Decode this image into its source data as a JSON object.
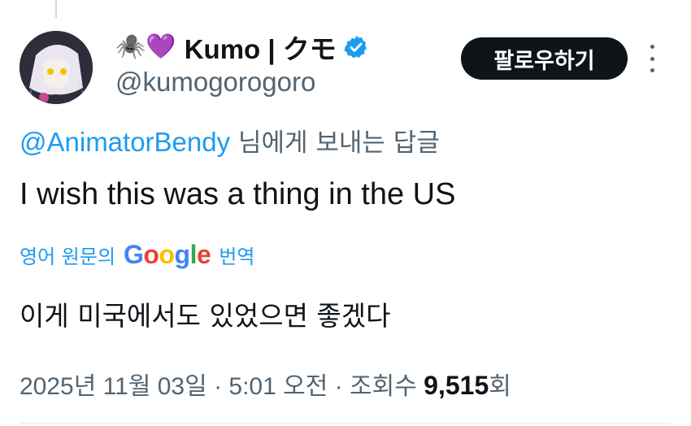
{
  "tweet": {
    "author": {
      "emoji_prefix": "🕷️💜",
      "display_name": "Kumo | クモ",
      "handle": "@kumogorogoro",
      "verified_color": "#1d9bf0"
    },
    "follow_label": "팔로우하기",
    "reply_to": {
      "mention": "@AnimatorBendy",
      "suffix": " 님에게 보내는 답글"
    },
    "text": "I wish this was a thing in the US",
    "translation": {
      "prefix": "영어 원문의",
      "brand": [
        "G",
        "o",
        "o",
        "g",
        "l",
        "e"
      ],
      "brand_colors": [
        "#4285f4",
        "#ea4335",
        "#fbbc05",
        "#4285f4",
        "#34a853",
        "#ea4335"
      ],
      "suffix": "번역",
      "text": "이게 미국에서도 있었으면 좋겠다"
    },
    "meta": {
      "date": "2025년 11월 03일",
      "separator": " · ",
      "time": "5:01 오전",
      "views_label": "조회수",
      "views_count": "9,515",
      "views_unit": "회"
    }
  }
}
